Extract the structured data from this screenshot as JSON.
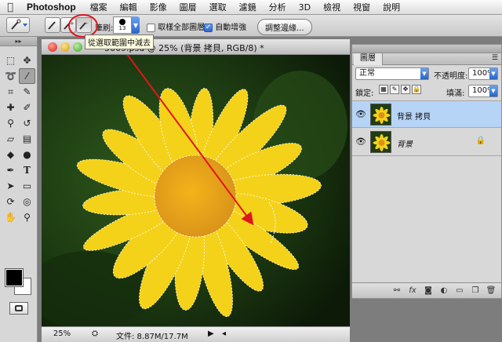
{
  "menubar": {
    "items": [
      "Photoshop",
      "檔案",
      "編輯",
      "影像",
      "圖層",
      "選取",
      "濾鏡",
      "分析",
      "3D",
      "檢視",
      "視窗",
      "說明"
    ]
  },
  "options_bar": {
    "brush_label": "筆刷:",
    "brush_size": "13",
    "sample_all_layers": "取樣全部圖層",
    "auto_enhance": "自動增強",
    "refine_edge": "調整邊緣...",
    "tooltip": "從選取範圍中減去"
  },
  "document": {
    "title": "5669.psd @ 25% (背景 拷貝, RGB/8) *",
    "zoom": "25%",
    "doc_size": "文件: 8.87M/17.7M"
  },
  "layers_panel": {
    "tab": "圖層",
    "blend_mode": "正常",
    "opacity_label": "不透明度:",
    "opacity": "100%",
    "lock_label": "鎖定:",
    "fill_label": "填滿:",
    "fill": "100%",
    "layers": [
      {
        "name": "背景 拷貝",
        "selected": true
      },
      {
        "name": "背景",
        "selected": false,
        "locked": true
      }
    ]
  },
  "colors": {
    "accent": "#2a64c6",
    "selected_layer": "#b6d4f6",
    "arrow": "#e0151c",
    "flower": "#f4d21a",
    "background": "#1f3d12"
  }
}
